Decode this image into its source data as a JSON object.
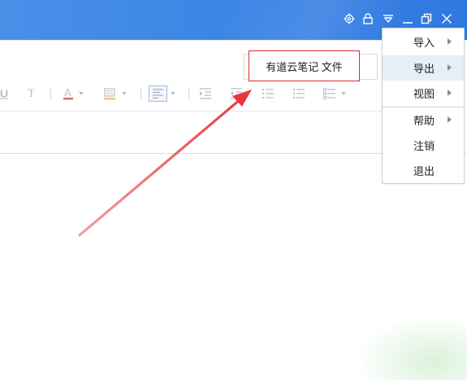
{
  "callout": {
    "text": "有道云笔记 文件"
  },
  "menu": {
    "items": [
      {
        "label": "导入",
        "submenu": true,
        "highlighted": false
      },
      {
        "label": "导出",
        "submenu": true,
        "highlighted": true
      },
      {
        "label": "视图",
        "submenu": true,
        "highlighted": false
      },
      {
        "label": "帮助",
        "submenu": true,
        "highlighted": false
      },
      {
        "label": "注销",
        "submenu": false,
        "highlighted": false
      },
      {
        "label": "退出",
        "submenu": false,
        "highlighted": false
      }
    ]
  },
  "toolbar": {
    "icons": [
      "underline-icon",
      "text-format-icon",
      "font-color-icon",
      "highlight-icon",
      "align-icon",
      "indent-icon",
      "outdent-icon",
      "ordered-list-icon",
      "bullet-list-icon",
      "checklist-icon"
    ],
    "underline_glyph": "U",
    "text_glyph": "T",
    "font_color_glyph": "A"
  },
  "titlebar": {
    "icons": [
      "settings-icon",
      "lock-icon",
      "menu-dropdown-icon",
      "minimize-icon",
      "restore-icon",
      "close-icon"
    ]
  },
  "colors": {
    "titlebar": "#3d86e6",
    "callout_border": "#e0272d",
    "arrow": "#e8383d",
    "menu_highlight": "#e6eef8"
  }
}
